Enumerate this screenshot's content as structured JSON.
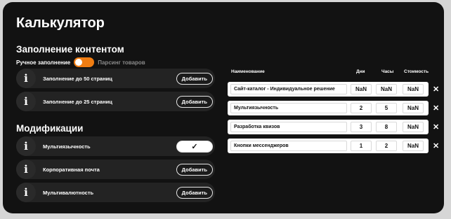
{
  "title": "Калькулятор",
  "content_fill": {
    "heading": "Заполнение контентом",
    "toggle": {
      "on_label": "Ручное заполнение",
      "off_label": "Парсинг товаров",
      "state": "on"
    },
    "items": [
      {
        "label": "Заполнение до 50 страниц",
        "button": "Добавить"
      },
      {
        "label": "Заполнение до 25 страниц",
        "button": "Добавить"
      }
    ]
  },
  "modifications": {
    "heading": "Модификации",
    "items": [
      {
        "label": "Мультиязычность",
        "button": "✓",
        "selected": true
      },
      {
        "label": "Корпоративная почта",
        "button": "Добавить",
        "selected": false
      },
      {
        "label": "Мультивалютность",
        "button": "Добавить",
        "selected": false
      }
    ]
  },
  "info_icon": "i",
  "table": {
    "headers": {
      "name": "Наименование",
      "days": "Дни",
      "hours": "Часы",
      "cost": "Стоимость"
    },
    "rows": [
      {
        "name": "Сайт-каталог - Индивидуальное решение",
        "days": "NaN",
        "hours": "NaN",
        "cost": "NaN"
      },
      {
        "name": "Мультиязычность",
        "days": "2",
        "hours": "5",
        "cost": "NaN"
      },
      {
        "name": "Разработка квизов",
        "days": "3",
        "hours": "8",
        "cost": "NaN"
      },
      {
        "name": "Кнопки мессенджеров",
        "days": "1",
        "hours": "2",
        "cost": "NaN"
      }
    ],
    "remove_label": "✕"
  },
  "colors": {
    "accent": "#f07d12",
    "panel": "#121212",
    "row": "#232323"
  },
  "icons": {
    "info": "info-icon",
    "remove": "close-icon",
    "check": "check-icon"
  }
}
